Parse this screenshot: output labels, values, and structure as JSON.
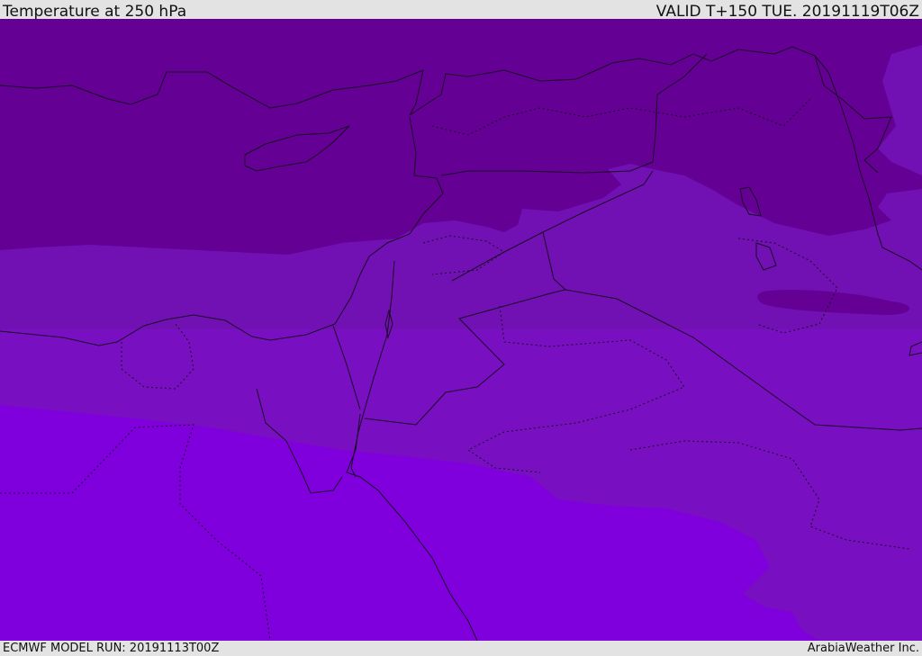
{
  "header": {
    "title": "Temperature at 250 hPa",
    "valid": "VALID T+150 TUE. 20191119T06Z"
  },
  "footer": {
    "model_run": "ECMWF MODEL RUN: 20191113T00Z",
    "credit": "ArabiaWeather Inc."
  },
  "colors": {
    "band_coldest": "#650095",
    "band_cold": "#7110b3",
    "band_mid": "#780fc0",
    "band_warm": "#7f00dc",
    "coastline": "#1a0a24",
    "border": "#1a0a24",
    "frame_bg": "#e3e3e3"
  }
}
